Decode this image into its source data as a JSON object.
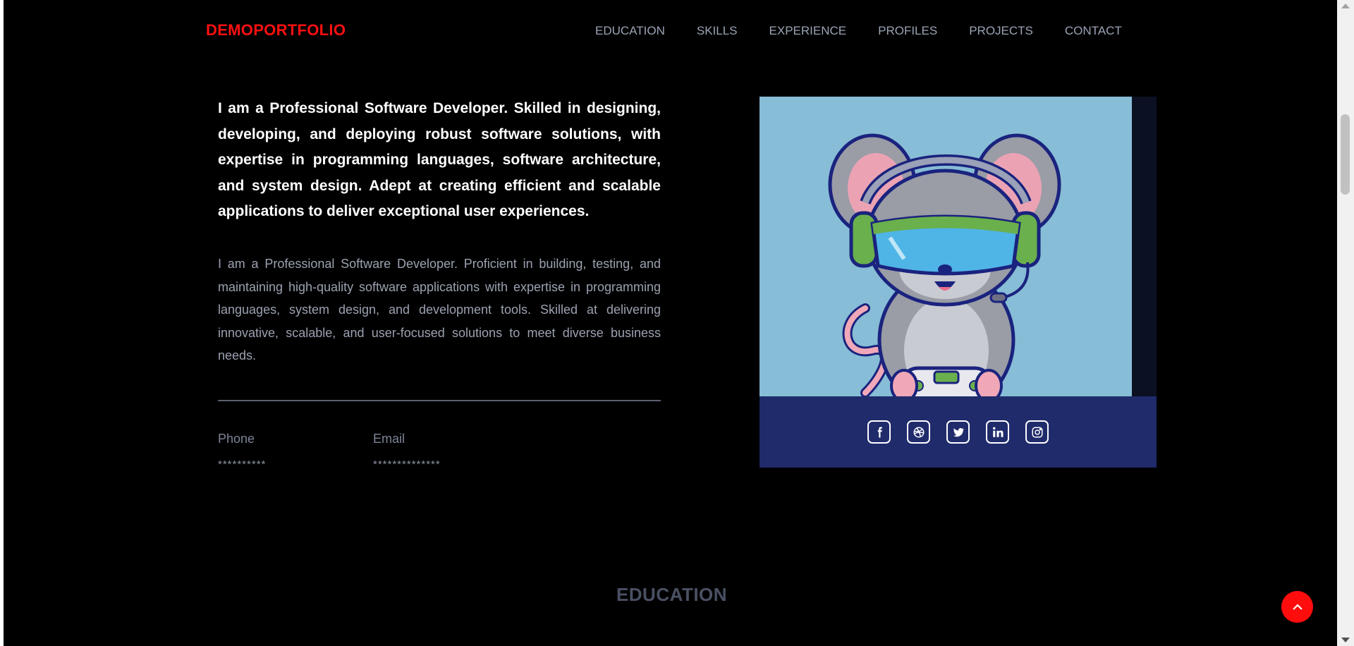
{
  "header": {
    "logo": "DEMOPORTFOLIO",
    "nav": [
      "EDUCATION",
      "SKILLS",
      "EXPERIENCE",
      "PROFILES",
      "PROJECTS",
      "CONTACT"
    ]
  },
  "intro": {
    "lead": "I am a Professional Software Developer. Skilled in designing, developing, and deploying robust software solutions, with expertise in programming languages, software architecture, and system design. Adept at creating efficient and scalable applications to deliver exceptional user experiences.",
    "description": "I am a Professional Software Developer. Proficient in building, testing, and maintaining high-quality software applications with expertise in programming languages, system design, and development tools. Skilled at delivering innovative, scalable, and user-focused solutions to meet diverse business needs."
  },
  "contact": {
    "phone_label": "Phone",
    "phone_value": "**********",
    "email_label": "Email",
    "email_value": "**************"
  },
  "profile_card": {
    "image": "cartoon-mouse-gamer-illustration",
    "socials": [
      "facebook-icon",
      "dribbble-icon",
      "twitter-icon",
      "linkedin-icon",
      "instagram-icon"
    ]
  },
  "sections": {
    "next_title": "EDUCATION"
  },
  "colors": {
    "brand": "#ff1010",
    "background": "#000000",
    "card_footer": "#1f2b6b",
    "card_image_bg": "#87bdd6",
    "back_to_top": "#ff0c0c"
  }
}
